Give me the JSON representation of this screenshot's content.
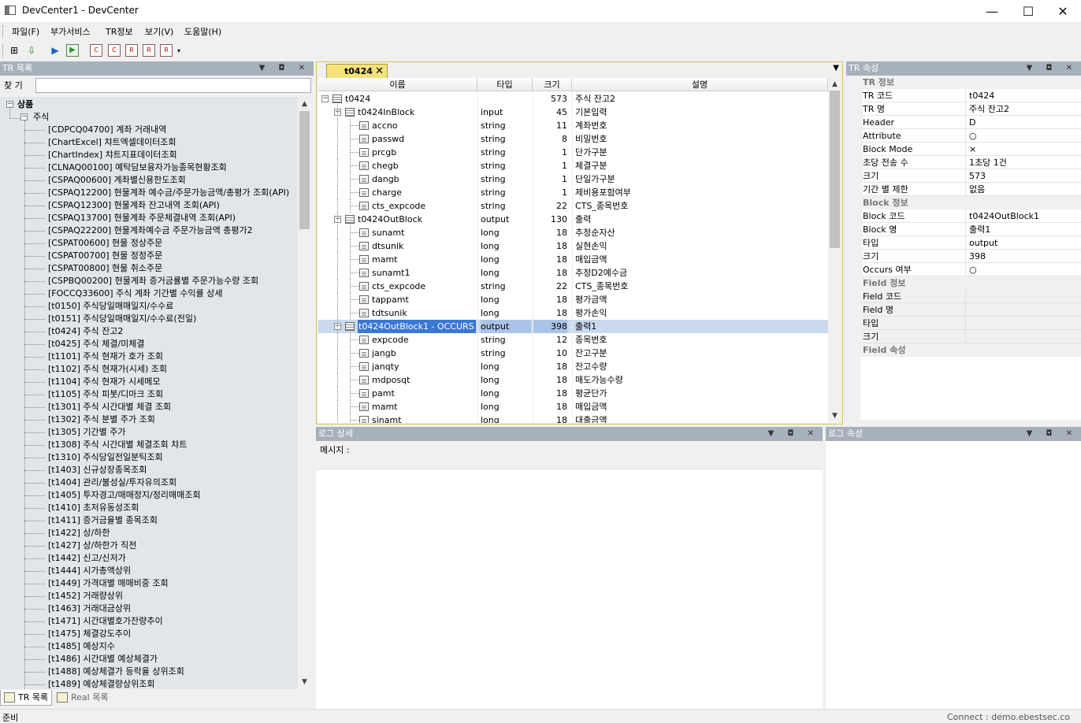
{
  "window": {
    "title": "DevCenter1 - DevCenter",
    "minimize": "—",
    "maximize": "☐",
    "close": "✕"
  },
  "menubar": [
    "파일(F)",
    "부가서비스",
    "TR정보",
    "보기(V)",
    "도움말(H)"
  ],
  "toolbar": {
    "icons": [
      "binoculars-icon",
      "save-download-icon",
      "play-icon",
      "play-step-icon",
      "doc-c-icon",
      "doc-copy-icon",
      "doc-r-icon",
      "doc-tr-icon",
      "doc-export-icon"
    ],
    "doc_letters": [
      "C",
      "C",
      "R",
      "R",
      "R"
    ]
  },
  "tr_list": {
    "caption": "TR 목록",
    "search_label": "찾 기",
    "search_value": "",
    "root": "상품",
    "group": "주식",
    "items": [
      "[CDPCQ04700] 계좌 거래내역",
      "[ChartExcel] 챠트엑셀데이터조회",
      "[ChartIndex] 챠트지표데이터조회",
      "[CLNAQ00100] 예탁담보융자가능종목현황조회",
      "[CSPAQ00600] 계좌별신용한도조회",
      "[CSPAQ12200] 현물계좌 예수금/주문가능금액/총평가 조회(API)",
      "[CSPAQ12300] 현물계좌 잔고내역 조회(API)",
      "[CSPAQ13700] 현물계좌 주문체결내역 조회(API)",
      "[CSPAQ22200] 현물계좌예수금 주문가능금액 총평가2",
      "[CSPAT00600] 현물 정상주문",
      "[CSPAT00700] 현물 정정주문",
      "[CSPAT00800] 현물 취소주문",
      "[CSPBQ00200] 현물계좌 증거금률별 주문가능수량 조회",
      "[FOCCQ33600] 주식 계좌 기간별 수익률 상세",
      "[t0150] 주식당일매매일지/수수료",
      "[t0151] 주식당일매매일지/수수료(전일)",
      "[t0424] 주식 잔고2",
      "[t0425] 주식 체결/미체결",
      "[t1101] 주식 현재가 호가 조회",
      "[t1102] 주식 현재가(시세) 조회",
      "[t1104] 주식 현재가 시세메모",
      "[t1105] 주식 피봇/디마크 조회",
      "[t1301] 주식 시간대별 체결 조회",
      "[t1302] 주식 분별 주가 조회",
      "[t1305] 기간별 주가",
      "[t1308] 주식 시간대별 체결조회 챠트",
      "[t1310] 주식당일전일분틱조회",
      "[t1403] 신규상장종목조회",
      "[t1404] 관리/불성실/투자유의조회",
      "[t1405] 투자경고/매매정지/정리매매조회",
      "[t1410] 초저유동성조회",
      "[t1411] 증거금율별 종목조회",
      "[t1422] 상/하한",
      "[t1427] 상/하한가 직전",
      "[t1442] 신고/신저가",
      "[t1444] 시가총액상위",
      "[t1449] 가격대별 매매비중 조회",
      "[t1452] 거래량상위",
      "[t1463] 거래대금상위",
      "[t1471] 시간대별호가잔량추이",
      "[t1475] 체결강도추이",
      "[t1485] 예상지수",
      "[t1486] 시간대별 예상체결가",
      "[t1488] 예상체결가 등락율 상위조회",
      "[t1489] 예상체결량상위조회"
    ],
    "tabs": [
      "TR 목록",
      "Real 목록"
    ]
  },
  "doc_tab": {
    "label": "t0424",
    "close": "✕",
    "menu": "▼"
  },
  "grid": {
    "headers": [
      "이름",
      "타입",
      "크기",
      "설명"
    ],
    "rows": [
      {
        "name": "t0424",
        "type": "",
        "size": "573",
        "desc": "주식 잔고2",
        "level": 0,
        "kind": "root"
      },
      {
        "name": "t0424InBlock",
        "type": "input",
        "size": "45",
        "desc": "기본입력",
        "level": 1,
        "kind": "block"
      },
      {
        "name": "accno",
        "type": "string",
        "size": "11",
        "desc": "계좌번호",
        "level": 2,
        "kind": "field"
      },
      {
        "name": "passwd",
        "type": "string",
        "size": "8",
        "desc": "비밀번호",
        "level": 2,
        "kind": "field"
      },
      {
        "name": "prcgb",
        "type": "string",
        "size": "1",
        "desc": "단가구분",
        "level": 2,
        "kind": "field"
      },
      {
        "name": "chegb",
        "type": "string",
        "size": "1",
        "desc": "체결구분",
        "level": 2,
        "kind": "field"
      },
      {
        "name": "dangb",
        "type": "string",
        "size": "1",
        "desc": "단일가구분",
        "level": 2,
        "kind": "field"
      },
      {
        "name": "charge",
        "type": "string",
        "size": "1",
        "desc": "제비용포함여부",
        "level": 2,
        "kind": "field"
      },
      {
        "name": "cts_expcode",
        "type": "string",
        "size": "22",
        "desc": "CTS_종목번호",
        "level": 2,
        "kind": "field"
      },
      {
        "name": "t0424OutBlock",
        "type": "output",
        "size": "130",
        "desc": "출력",
        "level": 1,
        "kind": "block"
      },
      {
        "name": "sunamt",
        "type": "long",
        "size": "18",
        "desc": "추정순자산",
        "level": 2,
        "kind": "field"
      },
      {
        "name": "dtsunik",
        "type": "long",
        "size": "18",
        "desc": "실현손익",
        "level": 2,
        "kind": "field"
      },
      {
        "name": "mamt",
        "type": "long",
        "size": "18",
        "desc": "매입금액",
        "level": 2,
        "kind": "field"
      },
      {
        "name": "sunamt1",
        "type": "long",
        "size": "18",
        "desc": "추정D2예수금",
        "level": 2,
        "kind": "field"
      },
      {
        "name": "cts_expcode",
        "type": "string",
        "size": "22",
        "desc": "CTS_종목번호",
        "level": 2,
        "kind": "field"
      },
      {
        "name": "tappamt",
        "type": "long",
        "size": "18",
        "desc": "평가금액",
        "level": 2,
        "kind": "field"
      },
      {
        "name": "tdtsunik",
        "type": "long",
        "size": "18",
        "desc": "평가손익",
        "level": 2,
        "kind": "field"
      },
      {
        "name": "t0424OutBlock1 - OCCURS",
        "type": "output",
        "size": "398",
        "desc": "출력1",
        "level": 1,
        "kind": "block",
        "selected": true
      },
      {
        "name": "expcode",
        "type": "string",
        "size": "12",
        "desc": "종목번호",
        "level": 2,
        "kind": "field"
      },
      {
        "name": "jangb",
        "type": "string",
        "size": "10",
        "desc": "잔고구분",
        "level": 2,
        "kind": "field"
      },
      {
        "name": "janqty",
        "type": "long",
        "size": "18",
        "desc": "잔고수량",
        "level": 2,
        "kind": "field"
      },
      {
        "name": "mdposqt",
        "type": "long",
        "size": "18",
        "desc": "매도가능수량",
        "level": 2,
        "kind": "field"
      },
      {
        "name": "pamt",
        "type": "long",
        "size": "18",
        "desc": "평균단가",
        "level": 2,
        "kind": "field"
      },
      {
        "name": "mamt",
        "type": "long",
        "size": "18",
        "desc": "매입금액",
        "level": 2,
        "kind": "field"
      },
      {
        "name": "sinamt",
        "type": "long",
        "size": "18",
        "desc": "대출금액",
        "level": 2,
        "kind": "field"
      }
    ]
  },
  "tr_props": {
    "caption": "TR 속성",
    "rows": [
      {
        "k": "TR 정보",
        "v": "",
        "cat": true
      },
      {
        "k": "TR 코드",
        "v": "t0424"
      },
      {
        "k": "TR 명",
        "v": "주식 잔고2"
      },
      {
        "k": "Header",
        "v": "D"
      },
      {
        "k": "Attribute",
        "v": "○"
      },
      {
        "k": "Block Mode",
        "v": "×"
      },
      {
        "k": "초당 전송 수",
        "v": "1초당 1건"
      },
      {
        "k": "크기",
        "v": "573"
      },
      {
        "k": "기간 별 제한",
        "v": "없음"
      },
      {
        "k": "Block 정보",
        "v": "",
        "cat": true
      },
      {
        "k": "Block 코드",
        "v": "t0424OutBlock1"
      },
      {
        "k": "Block 명",
        "v": "출력1"
      },
      {
        "k": "타입",
        "v": "output"
      },
      {
        "k": "크기",
        "v": "398"
      },
      {
        "k": "Occurs 여부",
        "v": "○"
      },
      {
        "k": "Field 정보",
        "v": "",
        "cat": true
      },
      {
        "k": "Field 코드",
        "v": "",
        "empty": true
      },
      {
        "k": "Field 명",
        "v": "",
        "empty": true
      },
      {
        "k": "타입",
        "v": "",
        "empty": true
      },
      {
        "k": "크기",
        "v": "",
        "empty": true
      },
      {
        "k": "Field 속성",
        "v": "",
        "cat": true
      }
    ]
  },
  "log_detail": {
    "caption": "로그 상세",
    "message_label": "메시지 :"
  },
  "log_props": {
    "caption": "로그 속성"
  },
  "pane_buttons": "▼ ◘ ✕",
  "status": {
    "left": "준비",
    "right": "Connect : demo.ebestsec.co"
  }
}
